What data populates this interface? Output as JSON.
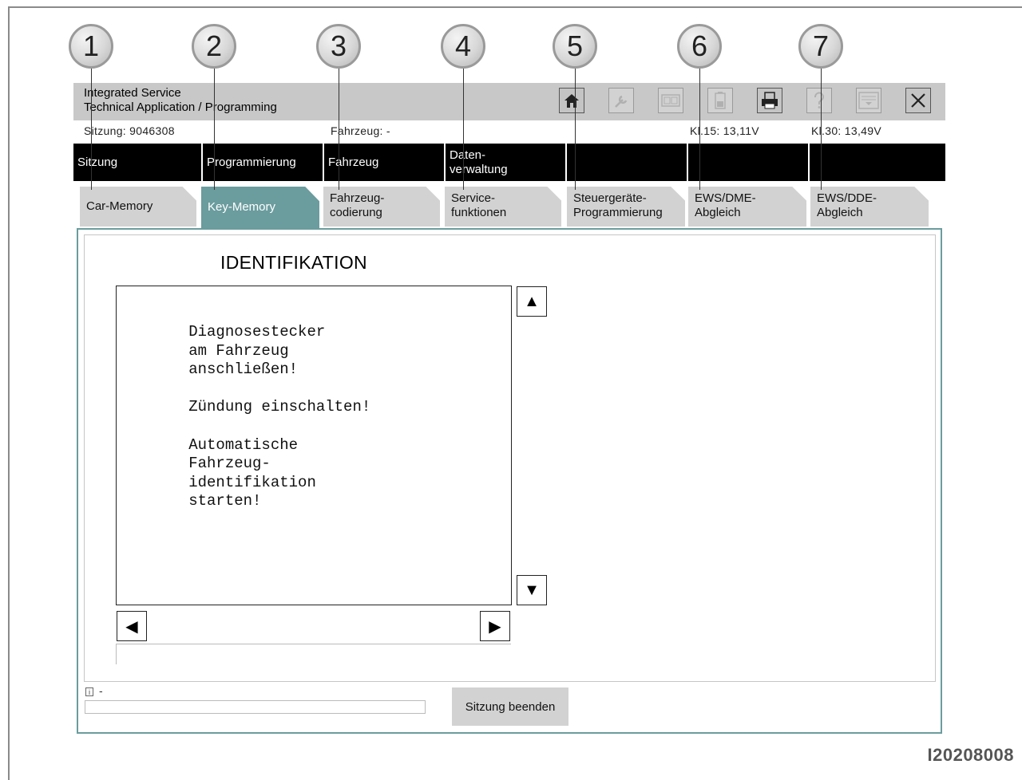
{
  "callouts": [
    "1",
    "2",
    "3",
    "4",
    "5",
    "6",
    "7"
  ],
  "app": {
    "title": "Integrated Service\nTechnical Application / Programming"
  },
  "toolbar": {
    "icons": [
      {
        "name": "home-icon",
        "active": true
      },
      {
        "name": "wrench-icon",
        "active": false
      },
      {
        "name": "screen-icon",
        "active": false
      },
      {
        "name": "battery-icon",
        "active": false
      },
      {
        "name": "printer-icon",
        "active": true
      },
      {
        "name": "help-icon",
        "active": false
      },
      {
        "name": "list-icon",
        "active": false
      },
      {
        "name": "close-icon",
        "active": true
      }
    ]
  },
  "status": {
    "session": "Sitzung: 9046308",
    "vehicle": "Fahrzeug: -",
    "kl15": "Kl.15: 13,11V",
    "kl30": "Kl.30: 13,49V"
  },
  "mainnav": [
    "Sitzung",
    "Programmierung",
    "Fahrzeug",
    "Daten-\nverwaltung",
    "",
    "",
    ""
  ],
  "subtabs": [
    {
      "label": "Car-Memory",
      "active": false
    },
    {
      "label": "Key-Memory",
      "active": true
    },
    {
      "label": "Fahrzeug-\ncodierung",
      "active": false
    },
    {
      "label": "Service-\nfunktionen",
      "active": false
    },
    {
      "label": "Steuergeräte-\nProgrammierung",
      "active": false
    },
    {
      "label": "EWS/DME-\nAbgleich",
      "active": false
    },
    {
      "label": "EWS/DDE-\nAbgleich",
      "active": false
    }
  ],
  "content": {
    "title": "IDENTIFIKATION",
    "lines": [
      "        Diagnosestecker",
      "        am Fahrzeug",
      "        anschließen!",
      "",
      "        Zündung einschalten!",
      "",
      "        Automatische",
      "        Fahrzeug-",
      "        identifikation",
      "        starten!"
    ]
  },
  "scroll": {
    "up": "▲",
    "down": "▼",
    "left": "◀",
    "right": "▶"
  },
  "info": {
    "icon": "i",
    "text": "-"
  },
  "buttons": {
    "end_session": "Sitzung beenden"
  },
  "figure_id": "I20208008"
}
